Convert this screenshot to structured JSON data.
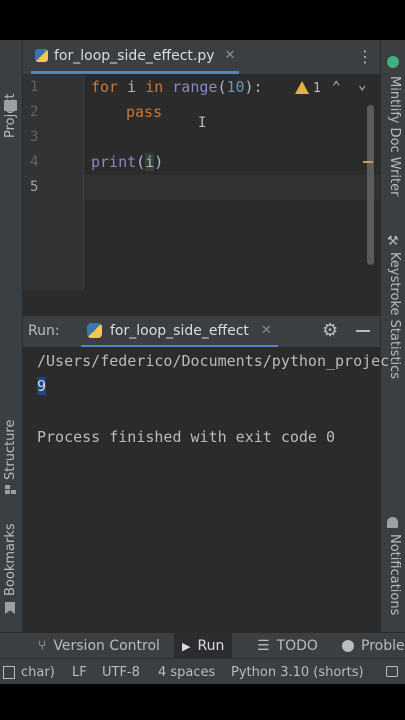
{
  "sidebar_left": {
    "project": "Project",
    "structure": "Structure",
    "bookmarks": "Bookmarks"
  },
  "sidebar_right": {
    "mintlify": "Mintlify Doc Writer",
    "keystroke": "Keystroke Statistics",
    "notifications": "Notifications"
  },
  "editor": {
    "tab_name": "for_loop_side_effect.py",
    "warning_count": "1",
    "line_numbers": [
      "1",
      "2",
      "3",
      "4",
      "5"
    ],
    "code": {
      "l1_kw_for": "for",
      "l1_var": " i ",
      "l1_kw_in": "in",
      "l1_builtin": " range",
      "l1_open": "(",
      "l1_num": "10",
      "l1_close": "):",
      "l2_kw_pass": "pass",
      "l4_builtin": "print",
      "l4_open": "(",
      "l4_var": "i",
      "l4_close": ")"
    }
  },
  "run_panel": {
    "label": "Run:",
    "config_name": "for_loop_side_effect",
    "output": {
      "path_line": "/Users/federico/Documents/python_projec",
      "value_line": "9",
      "exit_line": "Process finished with exit code 0"
    }
  },
  "tool_windows": {
    "version_control": "Version Control",
    "run": "Run",
    "todo": "TODO",
    "problems": "Probler"
  },
  "status": {
    "chars": "char)",
    "line_sep": "LF",
    "encoding": "UTF-8",
    "indent": "4 spaces",
    "interpreter": "Python 3.10 (shorts)"
  },
  "colors": {
    "accent": "#4a88c7",
    "keyword": "#cc7832",
    "builtin": "#8888c6",
    "number": "#6897bb",
    "warning": "#e2b33c"
  }
}
